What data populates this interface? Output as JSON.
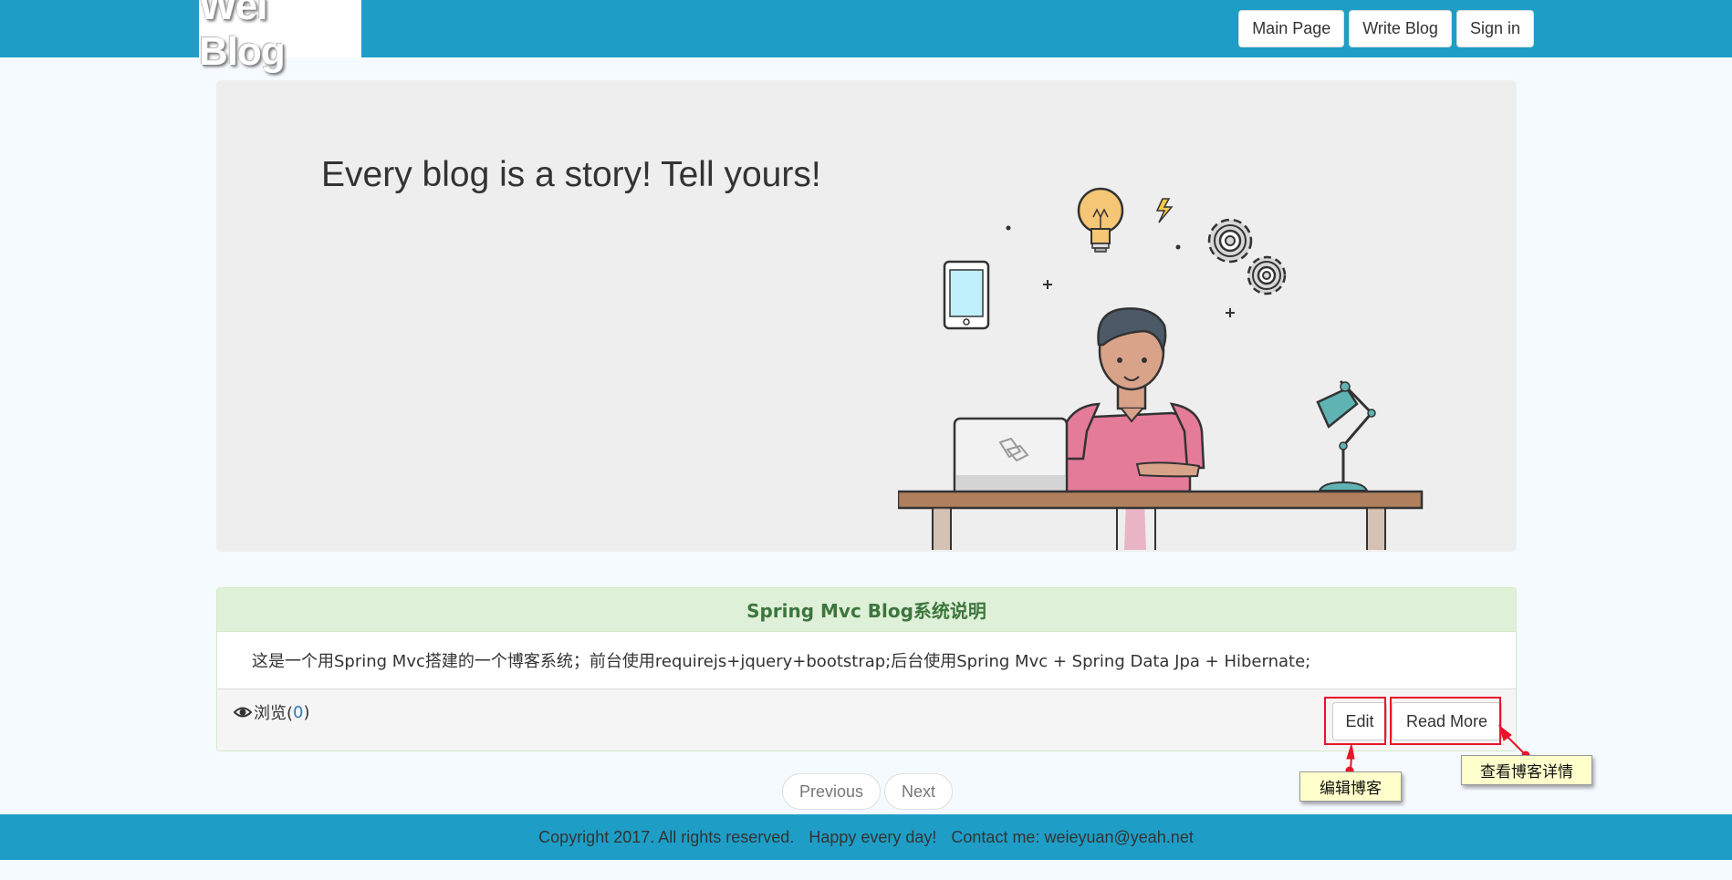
{
  "navbar": {
    "brand": "Wei Blog",
    "buttons": [
      "Main Page",
      "Write Blog",
      "Sign in"
    ]
  },
  "jumbotron": {
    "title": "Every blog is a story! Tell yours!"
  },
  "post": {
    "title": "Spring Mvc Blog系统说明",
    "summary": "这是一个用Spring Mvc搭建的一个博客系统；前台使用requirejs+jquery+bootstrap;后台使用Spring Mvc + Spring Data Jpa + Hibernate;",
    "views_label": "浏览(",
    "views_count": "0",
    "views_close": ")",
    "edit_label": "Edit",
    "read_more_label": "Read More"
  },
  "annotations": {
    "edit_callout": "编辑博客",
    "read_more_callout": "查看博客详情"
  },
  "pager": {
    "previous": "Previous",
    "next": "Next"
  },
  "footer": {
    "copyright": "Copyright 2017. All rights reserved.",
    "motto": "Happy every day!",
    "contact": "Contact me: weieyuan@yeah.net"
  },
  "colors": {
    "navbar": "#1e9ec7",
    "panel_heading": "#dff0d8",
    "panel_title": "#3c763d",
    "highlight": "#e8152b",
    "callout_bg": "#ffffcc"
  },
  "icons": [
    "eye-icon",
    "lightbulb-icon",
    "gear-icon",
    "phone-icon",
    "laptop-icon",
    "desk-lamp-icon",
    "lightning-icon"
  ]
}
